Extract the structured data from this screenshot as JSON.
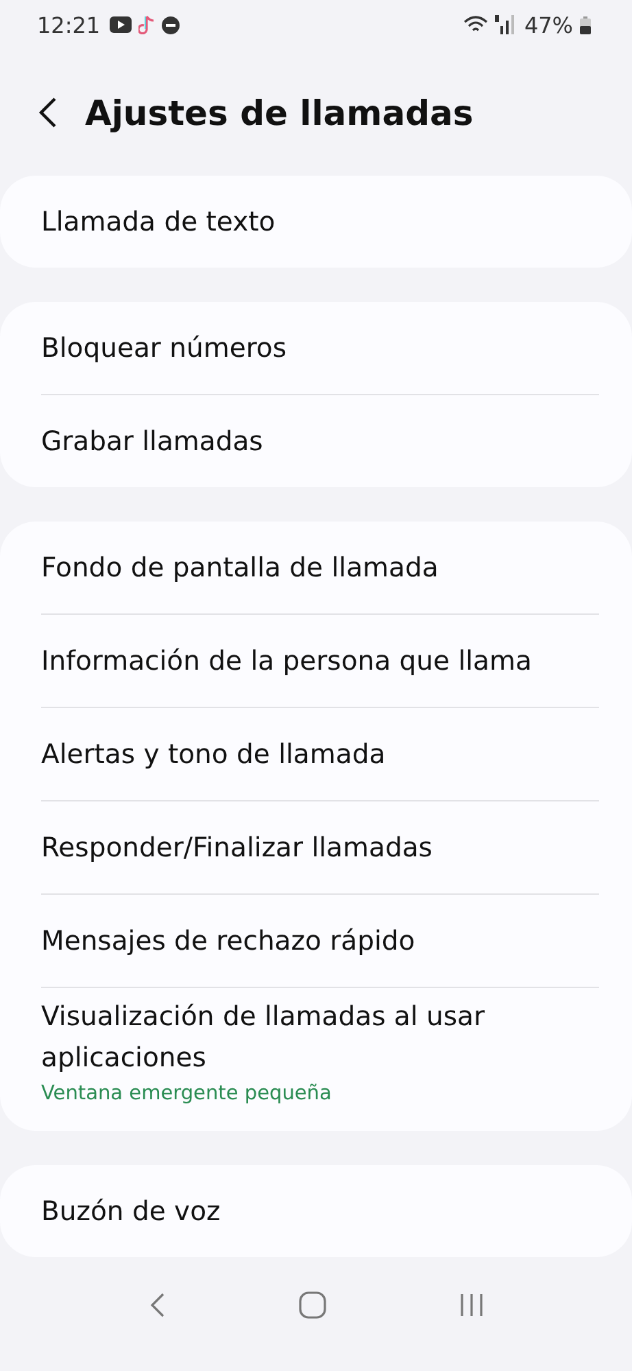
{
  "status_bar": {
    "time": "12:21",
    "battery": "47%"
  },
  "header": {
    "title": "Ajustes de llamadas"
  },
  "groups": [
    {
      "items": [
        {
          "label": "Llamada de texto"
        }
      ]
    },
    {
      "items": [
        {
          "label": "Bloquear números"
        },
        {
          "label": "Grabar llamadas"
        }
      ]
    },
    {
      "items": [
        {
          "label": "Fondo de pantalla de llamada"
        },
        {
          "label": "Información de la persona que llama"
        },
        {
          "label": "Alertas y tono de llamada"
        },
        {
          "label": "Responder/Finalizar llamadas"
        },
        {
          "label": "Mensajes de rechazo rápido"
        },
        {
          "label": "Visualización de llamadas al usar aplicaciones",
          "subtitle": "Ventana emergente pequeña"
        }
      ]
    },
    {
      "items": [
        {
          "label": "Buzón de voz"
        }
      ]
    }
  ]
}
